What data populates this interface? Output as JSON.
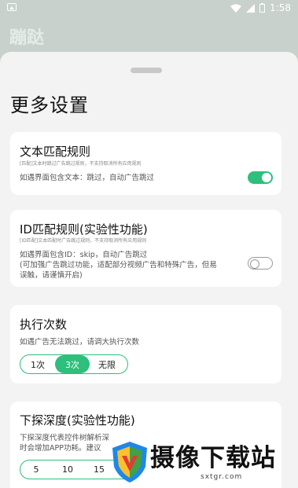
{
  "status": {
    "time": "1:58"
  },
  "background_title": "蹦跶",
  "page_title": "更多设置",
  "cards": {
    "text_match": {
      "title": "文本匹配规则",
      "sub": "[匹配]文本时跳过广告跳过规则，不支持取消所有应用规则",
      "desc": "如遇界面包含文本：跳过，自动广告跳过",
      "toggle": true
    },
    "id_match": {
      "title": "ID匹配规则(实验性功能)",
      "sub": "[ID匹配]文本匹配时广告跳过规则，不支持取消所有应用规则",
      "desc_lines": [
        "如遇界面包含ID：skip，自动广告跳过",
        "(可加强广告跳过功能，适配部分视频广告和特殊广告，但易",
        "误触，请谨慎开启)"
      ],
      "toggle": false
    },
    "exec_count": {
      "title": "执行次数",
      "desc": "如遇广告无法跳过，请调大执行次数",
      "options": [
        "1次",
        "3次",
        "无限"
      ],
      "selected": "3次"
    },
    "depth": {
      "title": "下探深度(实验性功能)",
      "desc_lines": [
        "下探深度代表控件树解析深",
        "时会增加APP功耗。建议"
      ],
      "options": [
        "5",
        "10",
        "15"
      ]
    }
  },
  "watermark": {
    "text": "摄像下载站",
    "url": "sxtgr.com"
  },
  "colors": {
    "accent": "#2dbf7b",
    "sheet_bg": "#f3f3f3"
  }
}
